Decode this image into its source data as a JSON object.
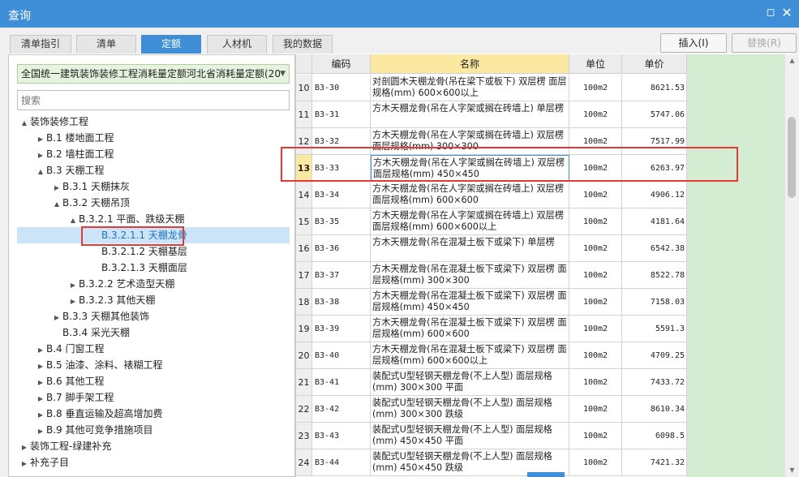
{
  "window": {
    "title": "查询",
    "max_icon": "maximize-icon",
    "close_icon": "close-icon"
  },
  "tabs": [
    {
      "label": "清单指引",
      "active": false
    },
    {
      "label": "清单",
      "active": false
    },
    {
      "label": "定额",
      "active": true
    },
    {
      "label": "人材机",
      "active": false
    },
    {
      "label": "我的数据",
      "active": false
    }
  ],
  "toolbar": {
    "insert_label": "插入(I)",
    "replace_label": "替换(R)"
  },
  "left": {
    "library_select": "全国统一建筑装饰装修工程消耗量定额河北省消耗量定额(20",
    "search_placeholder": "搜索",
    "tree": [
      {
        "label": "装饰装修工程",
        "toggle": "▲"
      },
      {
        "label": "B.1 楼地面工程",
        "toggle": "▶"
      },
      {
        "label": "B.2 墙柱面工程",
        "toggle": "▶"
      },
      {
        "label": "B.3 天棚工程",
        "toggle": "▲"
      },
      {
        "label": "B.3.1 天棚抹灰",
        "toggle": "▶"
      },
      {
        "label": "B.3.2 天棚吊顶",
        "toggle": "▲"
      },
      {
        "label": "B.3.2.1 平面、跌级天棚",
        "toggle": "▲"
      },
      {
        "label": "B.3.2.1.1 天棚龙骨",
        "toggle": ""
      },
      {
        "label": "B.3.2.1.2 天棚基层",
        "toggle": ""
      },
      {
        "label": "B.3.2.1.3 天棚面层",
        "toggle": ""
      },
      {
        "label": "B.3.2.2 艺术造型天棚",
        "toggle": "▶"
      },
      {
        "label": "B.3.2.3 其他天棚",
        "toggle": "▶"
      },
      {
        "label": "B.3.3 天棚其他装饰",
        "toggle": "▶"
      },
      {
        "label": "B.3.4 采光天棚",
        "toggle": ""
      },
      {
        "label": "B.4 门窗工程",
        "toggle": "▶"
      },
      {
        "label": "B.5 油漆、涂料、裱糊工程",
        "toggle": "▶"
      },
      {
        "label": "B.6 其他工程",
        "toggle": "▶"
      },
      {
        "label": "B.7 脚手架工程",
        "toggle": "▶"
      },
      {
        "label": "B.8 垂直运输及超高增加费",
        "toggle": "▶"
      },
      {
        "label": "B.9 其他可竞争措施项目",
        "toggle": "▶"
      },
      {
        "label": "装饰工程-绿建补充",
        "toggle": "▶"
      },
      {
        "label": "补充子目",
        "toggle": "▶"
      }
    ]
  },
  "table": {
    "headers": {
      "code": "编码",
      "name": "名称",
      "unit": "单位",
      "price": "单价"
    },
    "rows": [
      {
        "num": "10",
        "code": "B3-30",
        "name": "对剖圆木天棚龙骨(吊在梁下或板下) 双层楞 面层规格(mm) 600×600以上",
        "unit": "100m2",
        "price": "8621.53"
      },
      {
        "num": "11",
        "code": "B3-31",
        "name": "方木天棚龙骨(吊在人字架或搁在砖墙上) 单层楞",
        "unit": "100m2",
        "price": "5747.06"
      },
      {
        "num": "12",
        "code": "B3-32",
        "name": "方木天棚龙骨(吊在人字架或搁在砖墙上) 双层楞 面层规格(mm) 300×300",
        "unit": "100m2",
        "price": "7517.99"
      },
      {
        "num": "13",
        "code": "B3-33",
        "name": "方木天棚龙骨(吊在人字架或搁在砖墙上) 双层楞 面层规格(mm) 450×450",
        "unit": "100m2",
        "price": "6263.97"
      },
      {
        "num": "14",
        "code": "B3-34",
        "name": "方木天棚龙骨(吊在人字架或搁在砖墙上) 双层楞 面层规格(mm) 600×600",
        "unit": "100m2",
        "price": "4906.12"
      },
      {
        "num": "15",
        "code": "B3-35",
        "name": "方木天棚龙骨(吊在人字架或搁在砖墙上) 双层楞 面层规格(mm) 600×600以上",
        "unit": "100m2",
        "price": "4181.64"
      },
      {
        "num": "16",
        "code": "B3-36",
        "name": "方木天棚龙骨(吊在混凝土板下或梁下) 单层楞",
        "unit": "100m2",
        "price": "6542.38"
      },
      {
        "num": "17",
        "code": "B3-37",
        "name": "方木天棚龙骨(吊在混凝土板下或梁下) 双层楞 面层规格(mm) 300×300",
        "unit": "100m2",
        "price": "8522.78"
      },
      {
        "num": "18",
        "code": "B3-38",
        "name": "方木天棚龙骨(吊在混凝土板下或梁下) 双层楞 面层规格(mm) 450×450",
        "unit": "100m2",
        "price": "7158.03"
      },
      {
        "num": "19",
        "code": "B3-39",
        "name": "方木天棚龙骨(吊在混凝土板下或梁下) 双层楞 面层规格(mm) 600×600",
        "unit": "100m2",
        "price": "5591.3"
      },
      {
        "num": "20",
        "code": "B3-40",
        "name": "方木天棚龙骨(吊在混凝土板下或梁下) 双层楞 面层规格(mm) 600×600以上",
        "unit": "100m2",
        "price": "4709.25"
      },
      {
        "num": "21",
        "code": "B3-41",
        "name": "装配式U型轻钢天棚龙骨(不上人型) 面层规格(mm) 300×300 平面",
        "unit": "100m2",
        "price": "7433.72"
      },
      {
        "num": "22",
        "code": "B3-42",
        "name": "装配式U型轻钢天棚龙骨(不上人型) 面层规格(mm) 300×300 跌级",
        "unit": "100m2",
        "price": "8610.34"
      },
      {
        "num": "23",
        "code": "B3-43",
        "name": "装配式U型轻钢天棚龙骨(不上人型) 面层规格(mm) 450×450 平面",
        "unit": "100m2",
        "price": "6098.5"
      },
      {
        "num": "24",
        "code": "B3-44",
        "name": "装配式U型轻钢天棚龙骨(不上人型) 面层规格(mm) 450×450 跌级",
        "unit": "100m2",
        "price": "7421.32"
      }
    ]
  },
  "colors": {
    "accent": "#3e8fd8",
    "highlight_box": "#e53935",
    "header_name_bg": "#fbe9a2",
    "green_col": "#d4ecd2"
  }
}
